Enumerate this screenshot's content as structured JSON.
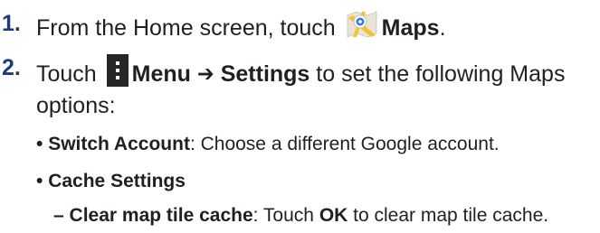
{
  "steps": [
    {
      "number": "1.",
      "text_before": "From the Home screen, touch",
      "icon": "maps-app-icon",
      "label": "Maps",
      "text_after": "."
    },
    {
      "number": "2.",
      "text_before": "Touch",
      "icon": "menu-icon",
      "label": "Menu",
      "arrow": "➔",
      "label2": "Settings",
      "text_after": "to set the following Maps",
      "continuation": "options:"
    }
  ],
  "bullets": [
    {
      "marker": "•",
      "label": "Switch Account",
      "text": ": Choose a different Google account."
    },
    {
      "marker": "•",
      "label": "Cache Settings",
      "text": ""
    }
  ],
  "sub_items": [
    {
      "marker": "–",
      "label": "Clear map tile cache",
      "text_a": ": Touch",
      "label2": "OK",
      "text_b": "to clear map tile cache."
    }
  ],
  "colors": {
    "step_number": "#1f3a7a",
    "body_text": "#231f20",
    "menu_icon_bg": "#262626",
    "menu_icon_dots": "#ffffff",
    "maps_icon_yellow": "#f2c231",
    "maps_icon_blue": "#3d7ad6",
    "maps_icon_ground": "#e9e4d6"
  }
}
